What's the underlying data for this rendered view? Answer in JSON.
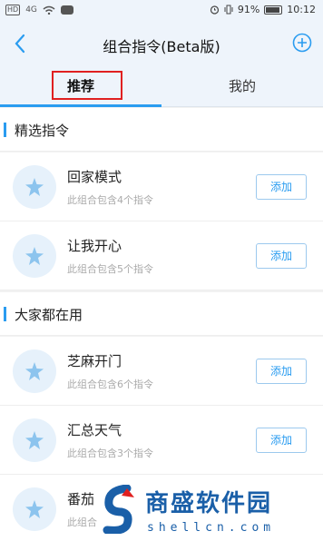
{
  "status_bar": {
    "left_badge": "HD",
    "signal": "4G",
    "right_text": "91%",
    "time": "10:12"
  },
  "nav": {
    "title": "组合指令(Beta版)"
  },
  "tabs": [
    {
      "label": "推荐",
      "active": true
    },
    {
      "label": "我的",
      "active": false
    }
  ],
  "sections": [
    {
      "title": "精选指令",
      "items": [
        {
          "name": "回家模式",
          "desc": "此组合包含4个指令",
          "button": "添加"
        },
        {
          "name": "让我开心",
          "desc": "此组合包含5个指令",
          "button": "添加"
        }
      ]
    },
    {
      "title": "大家都在用",
      "items": [
        {
          "name": "芝麻开门",
          "desc": "此组合包含6个指令",
          "button": "添加"
        },
        {
          "name": "汇总天气",
          "desc": "此组合包含3个指令",
          "button": "添加"
        },
        {
          "name": "番茄",
          "desc": "此组合",
          "button": "添加"
        }
      ]
    }
  ],
  "watermark": {
    "cn": "商盛软件园",
    "url": "shellcn.com"
  },
  "colors": {
    "accent": "#2a9cf0",
    "highlight_box": "#e02020",
    "header_bg": "#eef4fb"
  },
  "icons": {
    "item_icon": "star-icon",
    "back": "chevron-left-icon",
    "add": "plus-circle-icon"
  }
}
